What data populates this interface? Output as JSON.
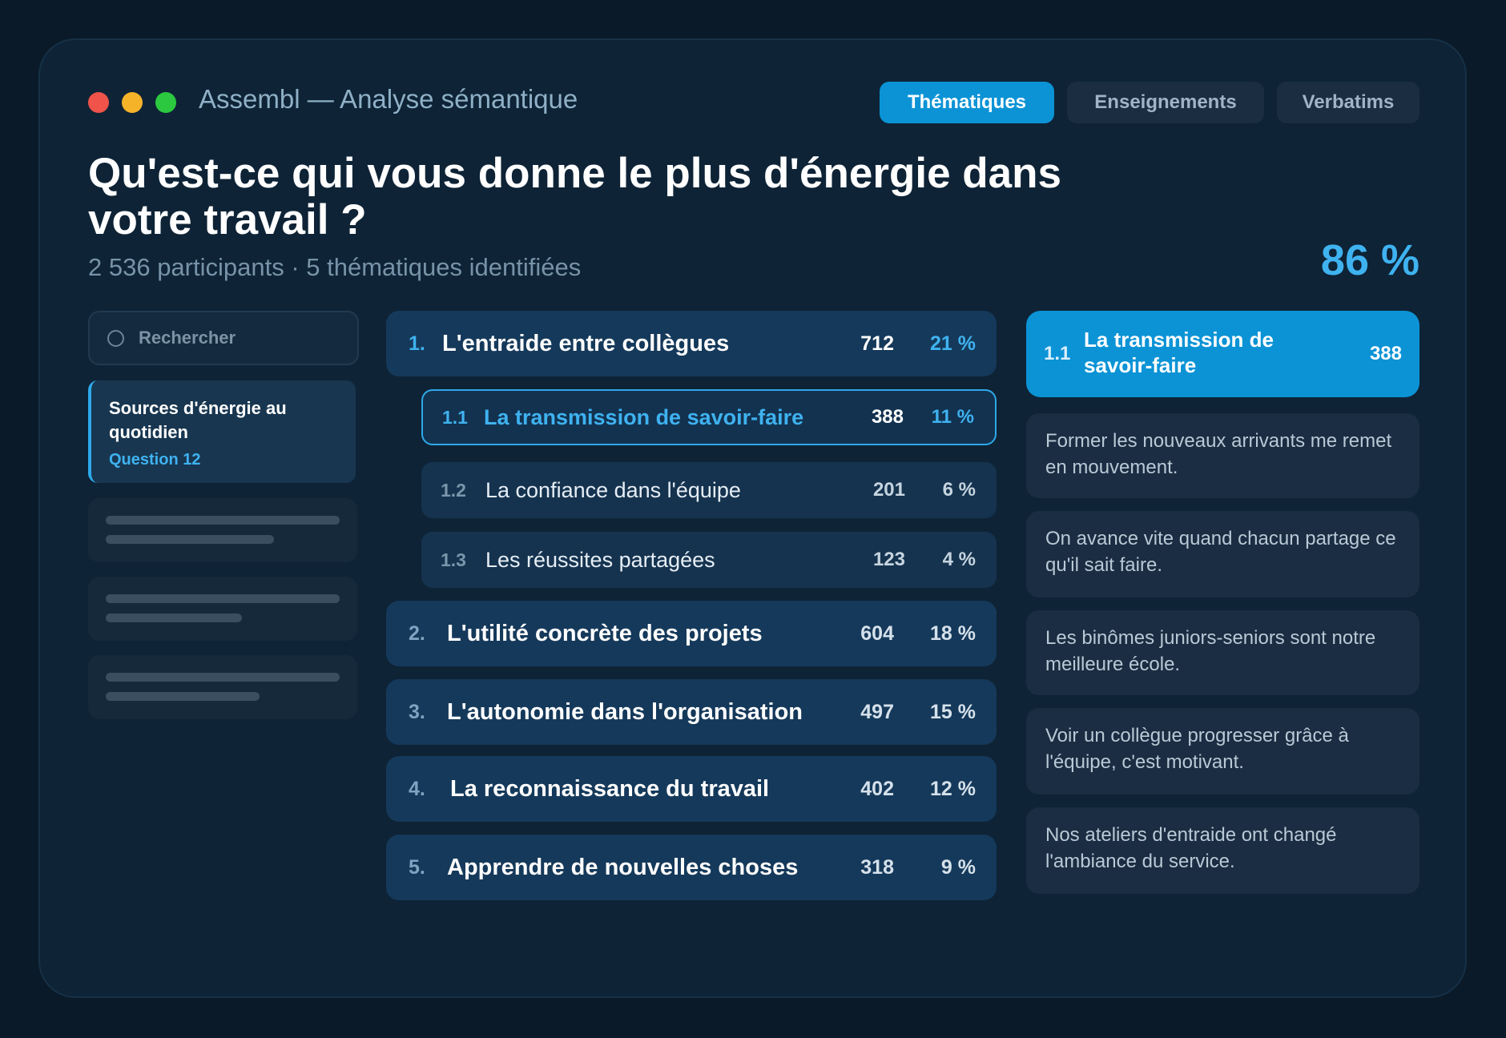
{
  "window": {
    "title": "Assembl — Analyse sémantique",
    "traffic_lights": [
      "#f0534a",
      "#f5b32a",
      "#2cc840"
    ]
  },
  "tabs": [
    {
      "label": "Thématiques",
      "active": true
    },
    {
      "label": "Enseignements",
      "active": false
    },
    {
      "label": "Verbatims",
      "active": false
    }
  ],
  "header": {
    "question": "Qu'est-ce qui vous donne le plus d'énergie dans votre travail ?",
    "subtitle": "2 536 participants · 5 thématiques identifiées",
    "big_percent": "86 %"
  },
  "sidebar": {
    "search_placeholder": "Rechercher",
    "active_item": {
      "title": "Sources d'énergie au quotidien",
      "question": "Question 12"
    }
  },
  "themes": [
    {
      "num": "1.",
      "label": "L'entraide entre collègues",
      "count": "712",
      "percent": "21 %"
    },
    {
      "num": "2.",
      "label": "L'utilité concrète des projets",
      "count": "604",
      "percent": "18 %"
    },
    {
      "num": "3.",
      "label": "L'autonomie dans l'organisation",
      "count": "497",
      "percent": "15 %"
    },
    {
      "num": "4.",
      "label": "La reconnaissance du travail",
      "count": "402",
      "percent": "12 %"
    },
    {
      "num": "5.",
      "label": "Apprendre de nouvelles choses",
      "count": "318",
      "percent": "9 %"
    }
  ],
  "subthemes": [
    {
      "num": "1.1",
      "label": "La transmission de savoir-faire",
      "count": "388",
      "percent": "11 %"
    },
    {
      "num": "1.2",
      "label": "La confiance dans l'équipe",
      "count": "201",
      "percent": "6 %"
    },
    {
      "num": "1.3",
      "label": "Les réussites partagées",
      "count": "123",
      "percent": "4 %"
    }
  ],
  "detail": {
    "num": "1.1",
    "label": "La transmission de savoir-faire",
    "count": "388",
    "verbatims": [
      "Former les nouveaux arrivants me remet en mouvement.",
      "On avance vite quand chacun partage ce qu'il sait faire.",
      "Les binômes juniors-seniors sont notre meilleure école.",
      "Voir un collègue progresser grâce à l'équipe, c'est motivant.",
      "Nos ateliers d'entraide ont changé l'ambiance du service."
    ]
  },
  "colors": {
    "accent": "#0b93d6",
    "accent_text": "#3fb2f0"
  }
}
